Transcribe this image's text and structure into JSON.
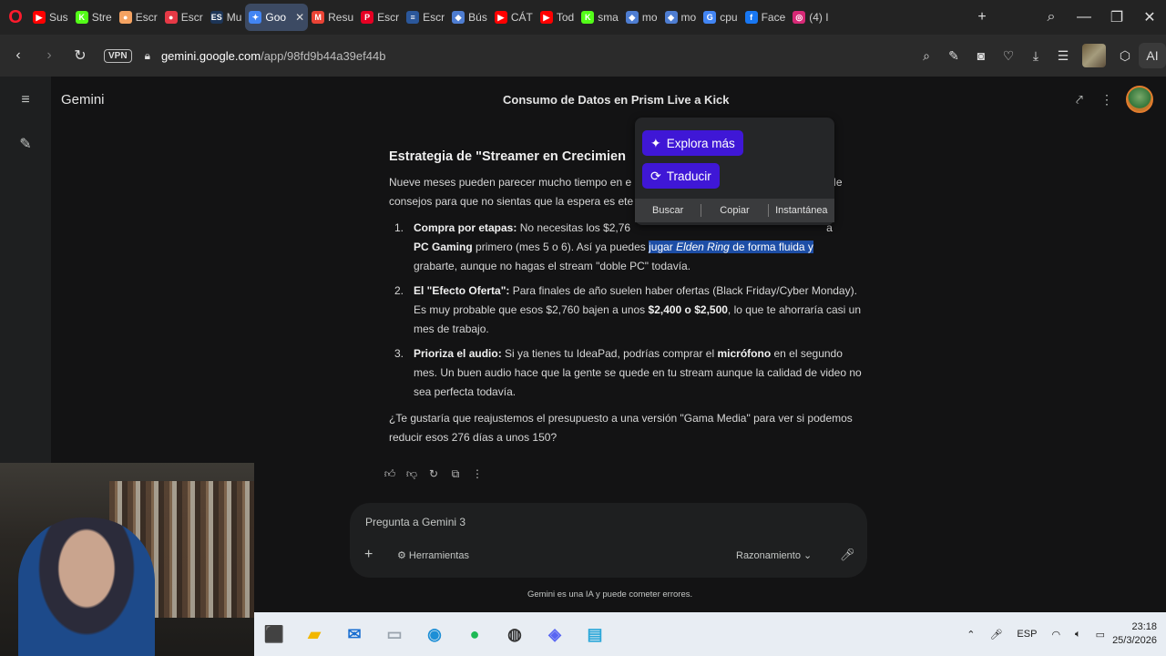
{
  "browser": {
    "tabs": [
      {
        "label": "Sus",
        "fav": "youtube-icon",
        "color": "#ff0000",
        "glyph": "▶"
      },
      {
        "label": "Stre",
        "fav": "kick-icon",
        "color": "#53fc18",
        "glyph": "K"
      },
      {
        "label": "Escr",
        "fav": "chat-icon",
        "color": "#f4a261",
        "glyph": "●"
      },
      {
        "label": "Escr",
        "fav": "mic-icon",
        "color": "#e63946",
        "glyph": "●"
      },
      {
        "label": "Mu",
        "fav": "es-icon",
        "color": "#1d3557",
        "glyph": "ES"
      },
      {
        "label": "Goo",
        "fav": "gemini-icon",
        "color": "#4285f4",
        "glyph": "✦",
        "active": true
      },
      {
        "label": "Resu",
        "fav": "gmail-icon",
        "color": "#ea4335",
        "glyph": "M"
      },
      {
        "label": "Escr",
        "fav": "pinterest-icon",
        "color": "#e60023",
        "glyph": "P"
      },
      {
        "label": "Escr",
        "fav": "doc-icon",
        "color": "#2b579a",
        "glyph": "≡"
      },
      {
        "label": "Bús",
        "fav": "drive-icon",
        "color": "#4e7dd1",
        "glyph": "◆"
      },
      {
        "label": "CÁT",
        "fav": "youtube-icon",
        "color": "#ff0000",
        "glyph": "▶"
      },
      {
        "label": "Tod",
        "fav": "youtube-icon",
        "color": "#ff0000",
        "glyph": "▶"
      },
      {
        "label": "sma",
        "fav": "kick-icon",
        "color": "#53fc18",
        "glyph": "K"
      },
      {
        "label": "mo",
        "fav": "drive-icon",
        "color": "#4e7dd1",
        "glyph": "◆"
      },
      {
        "label": "mo",
        "fav": "drive-icon",
        "color": "#4e7dd1",
        "glyph": "◆"
      },
      {
        "label": "cpu",
        "fav": "google-icon",
        "color": "#4285f4",
        "glyph": "G"
      },
      {
        "label": "Face",
        "fav": "facebook-icon",
        "color": "#1877f2",
        "glyph": "f"
      },
      {
        "label": "(4) I",
        "fav": "instagram-icon",
        "color": "#d62976",
        "glyph": "◎"
      }
    ],
    "vpn_label": "VPN",
    "url_host": "gemini.google.com",
    "url_path": "/app/98fd9b44a39ef44b",
    "ai_label": "AI"
  },
  "gemini": {
    "brand": "Gemini",
    "conversation_title": "Consumo de Datos en Prism Live a Kick",
    "heading": "Estrategia de \"Streamer en Crecimien",
    "intro_a": "Nueve meses pueden parecer mucho tiempo en e",
    "intro_b": "de",
    "intro_line2": "consejos para que no sientas que la espera es ete",
    "items": [
      {
        "num": "1.",
        "bold": "Compra por etapas:",
        "text_a": " No necesitas los $2,76",
        "text_b": "a",
        "bold2": "PC Gaming",
        "text_c": " primero (mes 5 o 6). Así ya puedes ",
        "hl_a": "jugar ",
        "hl_em": "Elden Ring",
        "hl_b": " de forma fluida y",
        "text_d": "grabarte, aunque no hagas el stream \"doble PC\" todavía."
      },
      {
        "num": "2.",
        "bold": "El \"Efecto Oferta\":",
        "text_a": " Para finales de año suelen haber ofertas (Black Friday/Cyber Monday). Es muy probable que esos $2,760 bajen a unos ",
        "bold2": "$2,400 o $2,500",
        "text_c": ", lo que te ahorraría casi un mes de trabajo."
      },
      {
        "num": "3.",
        "bold": "Prioriza el audio:",
        "text_a": " Si ya tienes tu IdeaPad, podrías comprar el ",
        "bold2": "micrófono",
        "text_c": " en el segundo mes. Un buen audio hace que la gente se quede en tu stream aunque la calidad de video no sea perfecta todavía."
      }
    ],
    "closing": "¿Te gustaría que reajustemos el presupuesto a una versión \"Gama Media\" para ver si podemos reducir esos 276 días a unos 150?",
    "popup": {
      "explore_label": "Explora más",
      "translate_label": "Traducir",
      "search_label": "Buscar",
      "copy_label": "Copiar",
      "snapshot_label": "Instantánea"
    },
    "composer": {
      "placeholder": "Pregunta a Gemini 3",
      "tools_label": "Herramientas",
      "mode_label": "Razonamiento"
    },
    "disclaimer": "Gemini es una IA y puede cometer errores."
  },
  "taskbar": {
    "apps": [
      {
        "name": "acrobat-icon",
        "glyph": "⬛",
        "color": "#d4312d"
      },
      {
        "name": "file-explorer-icon",
        "glyph": "▰",
        "color": "#f2b700"
      },
      {
        "name": "outlook-icon",
        "glyph": "✉",
        "color": "#1a6fd1"
      },
      {
        "name": "folder-icon",
        "glyph": "▭",
        "color": "#9aa4ae"
      },
      {
        "name": "edge-icon",
        "glyph": "◉",
        "color": "#1d8fd6"
      },
      {
        "name": "spotify-icon",
        "glyph": "●",
        "color": "#1db954"
      },
      {
        "name": "obs-icon",
        "glyph": "◍",
        "color": "#333333"
      },
      {
        "name": "discord-icon",
        "glyph": "◈",
        "color": "#5865f2"
      },
      {
        "name": "notepad-icon",
        "glyph": "▤",
        "color": "#2aa7d9"
      }
    ],
    "lang": "ESP",
    "time": "23:18",
    "date": "25/3/2026"
  }
}
